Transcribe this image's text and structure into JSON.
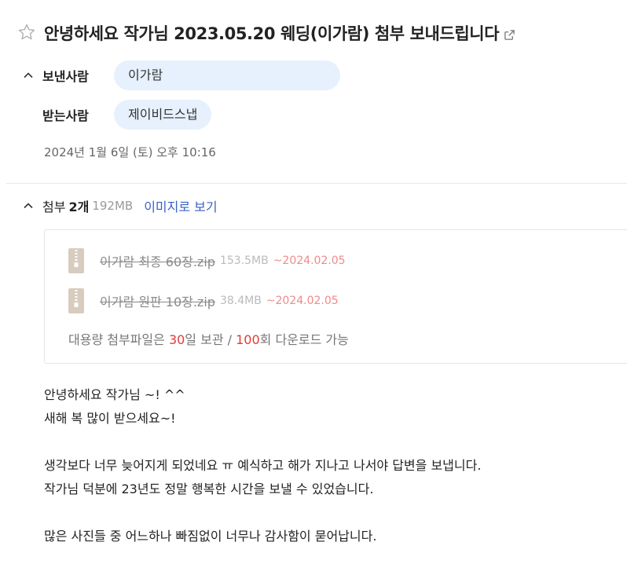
{
  "email": {
    "subject": "안녕하세요 작가님 2023.05.20 웨딩(이가람) 첨부 보내드립니다",
    "sender_label": "보낸사람",
    "sender": "이가람",
    "recipient_label": "받는사람",
    "recipient": "제이비드스냅",
    "date": "2024년 1월 6일 (토) 오후 10:16"
  },
  "attachments": {
    "label": "첨부",
    "count": "2개",
    "total_size": "192MB",
    "view_as_image": "이미지로 보기",
    "files": [
      {
        "name": "이가람 최종 60장.zip",
        "size": "153.5MB",
        "expires": "~2024.02.05"
      },
      {
        "name": "이가람 원판 10장.zip",
        "size": "38.4MB",
        "expires": "~2024.02.05"
      }
    ],
    "note": {
      "part1": "대용량 첨부파일은 ",
      "days": "30",
      "part2": "일 보관 / ",
      "downloads": "100",
      "part3": "회 다운로드 가능"
    }
  },
  "body": {
    "lines": [
      "안녕하세요 작가님 ~! ^^",
      "새해 복 많이 받으세요~!",
      "",
      "생각보다 너무 늦어지게 되었네요 ㅠ 예식하고 해가 지나고 나서야 답변을 보냅니다.",
      "작가님 덕분에 23년도 정말 행복한 시간을 보낼 수 있었습니다.",
      "",
      "많은 사진들 중 어느하나 빠짐없이 너무나 감사함이 묻어납니다."
    ]
  }
}
